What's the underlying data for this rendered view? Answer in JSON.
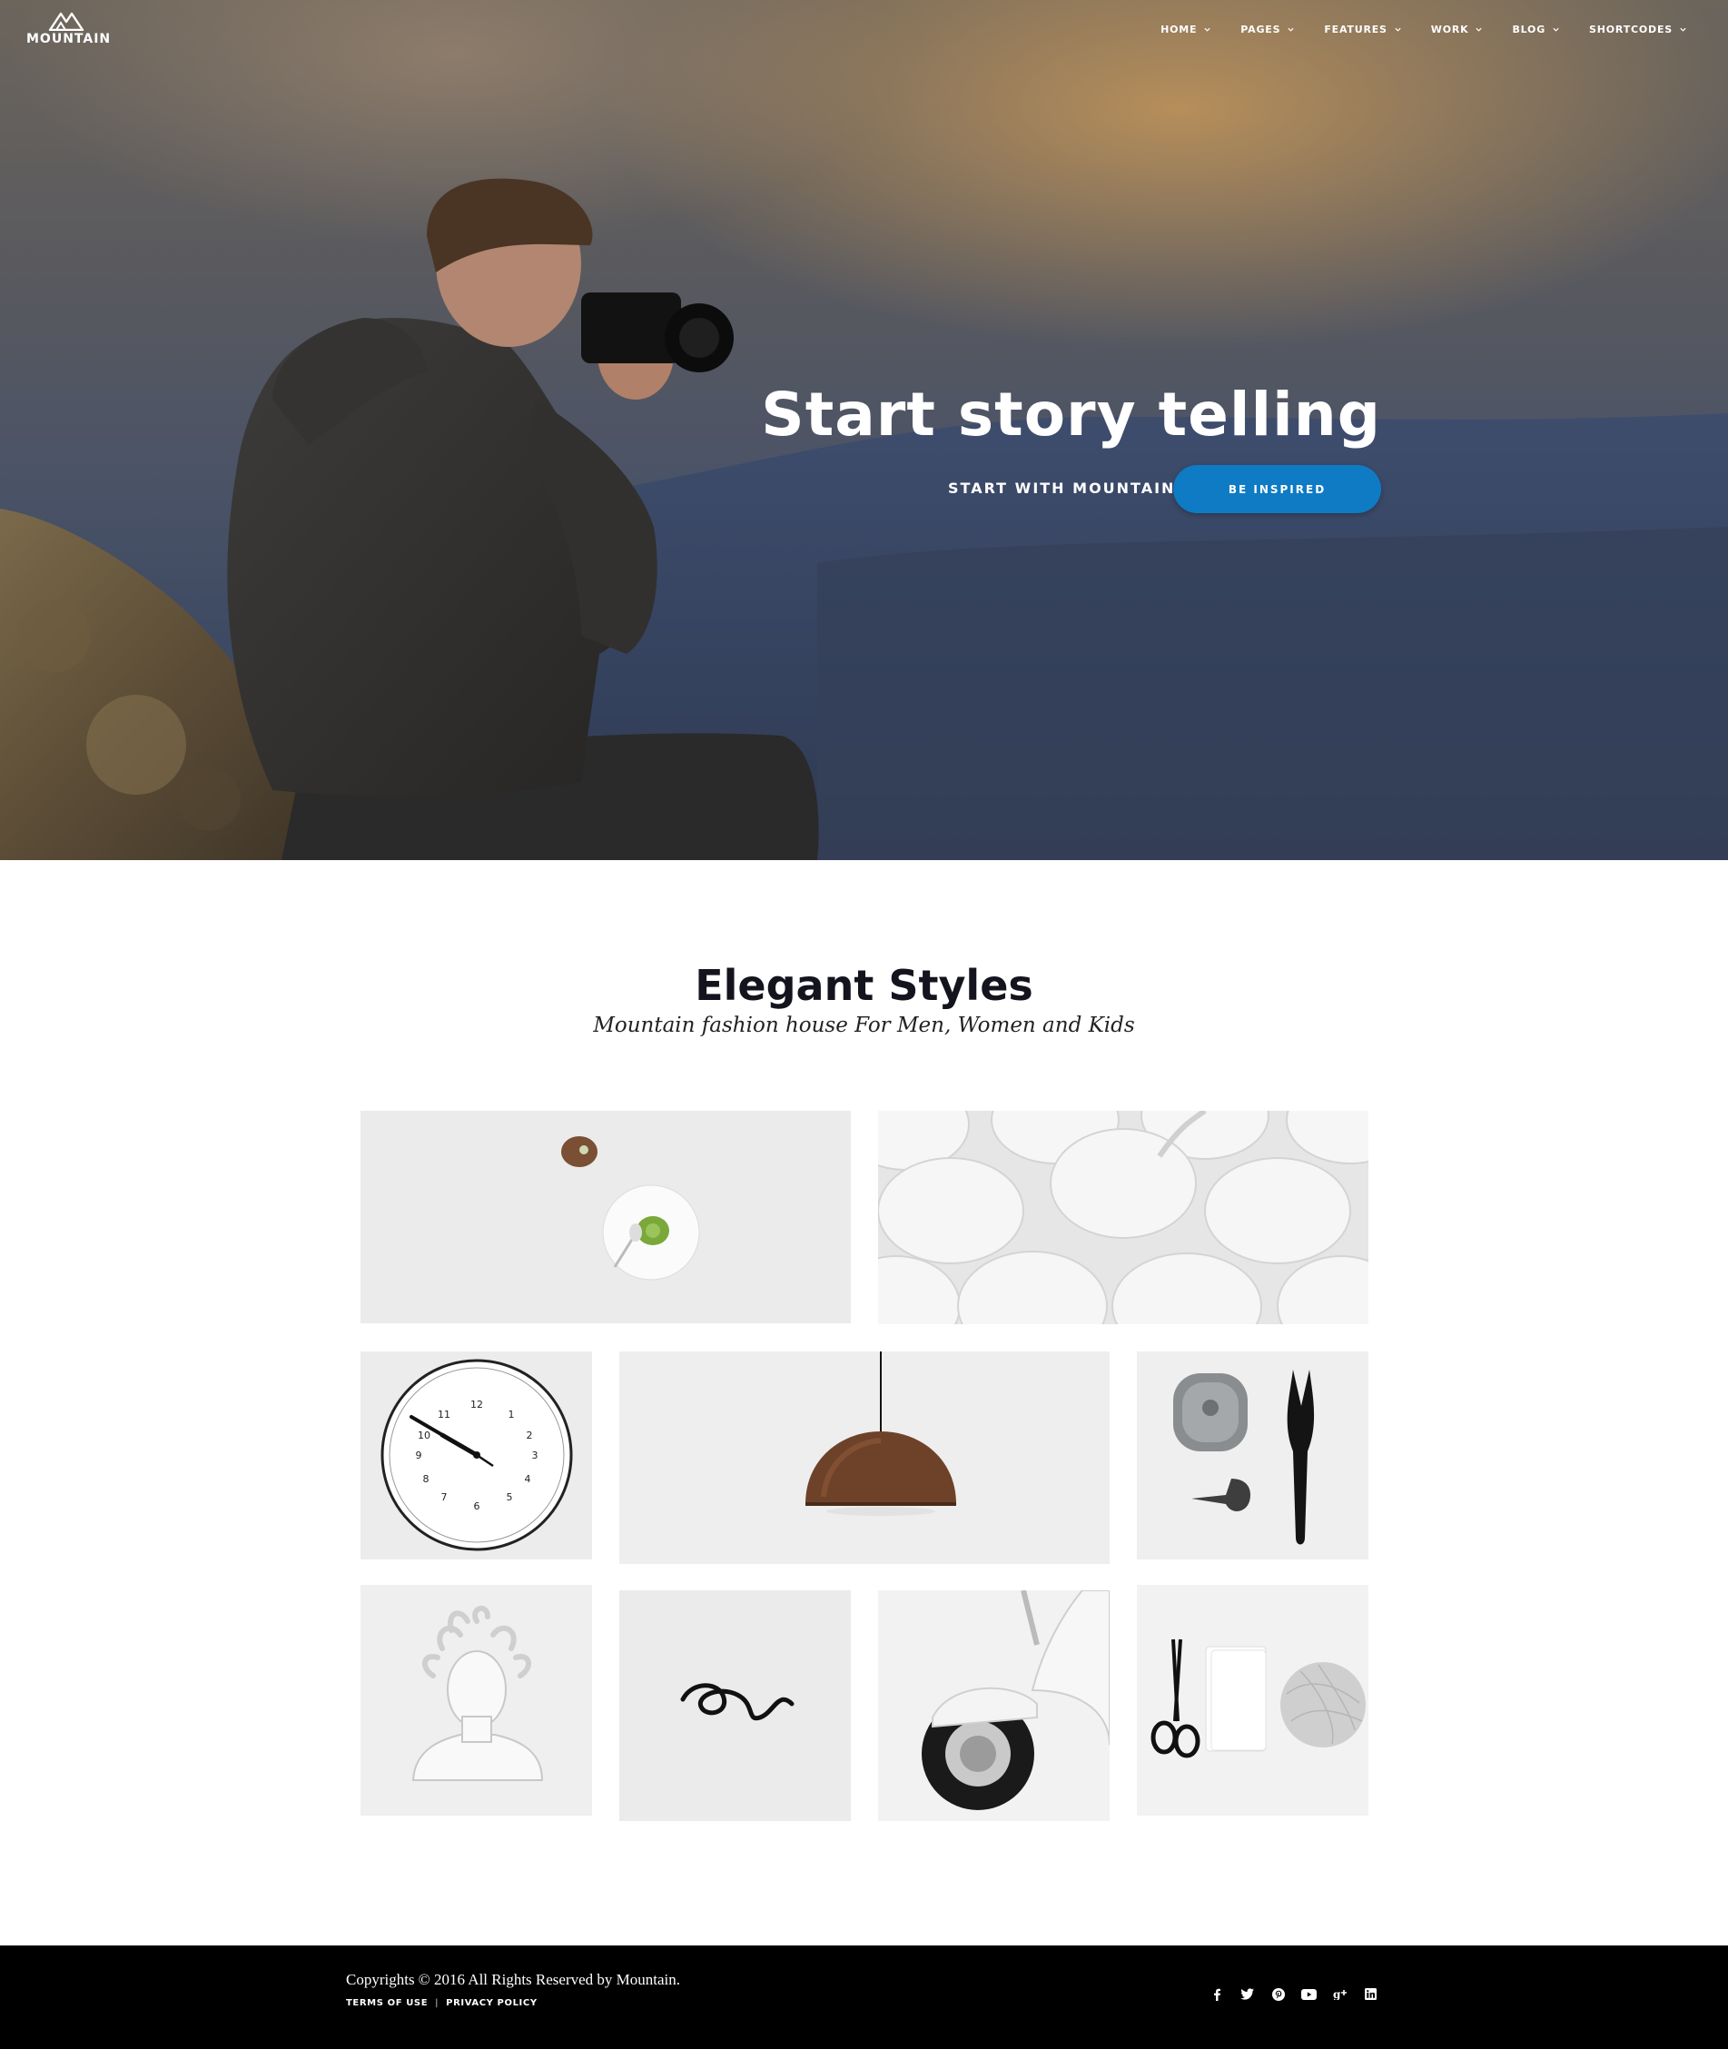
{
  "brand": {
    "name": "MOUNTAIN"
  },
  "nav": {
    "items": [
      {
        "label": "HOME"
      },
      {
        "label": "PAGES"
      },
      {
        "label": "FEATURES"
      },
      {
        "label": "WORK"
      },
      {
        "label": "BLOG"
      },
      {
        "label": "SHORTCODES"
      }
    ]
  },
  "hero": {
    "title": "Start story telling",
    "subtitle": "START WITH MOUNTAIN",
    "button_label": "BE INSPIRED",
    "accent_color": "#0e7bc4"
  },
  "section": {
    "title": "Elegant Styles",
    "subtitle": "Mountain fashion house For Men, Women and Kids",
    "gallery": [
      {
        "icon": "kiwi-plate-image"
      },
      {
        "icon": "white-bowls-image"
      },
      {
        "icon": "wall-clock-image"
      },
      {
        "icon": "pendant-lamp-image"
      },
      {
        "icon": "tape-measure-scissors-image"
      },
      {
        "icon": "medusa-bust-image"
      },
      {
        "icon": "black-ribbon-image"
      },
      {
        "icon": "scooter-wheel-image"
      },
      {
        "icon": "scissors-notebook-yarn-image"
      }
    ]
  },
  "footer": {
    "copyright": "Copyrights © 2016 All Rights Reserved by Mountain.",
    "terms": "TERMS OF USE",
    "separator": "|",
    "privacy": "PRIVACY POLICY",
    "social": [
      "facebook-icon",
      "twitter-icon",
      "pinterest-icon",
      "youtube-icon",
      "google-plus-icon",
      "linkedin-icon"
    ],
    "background": "#000000"
  }
}
